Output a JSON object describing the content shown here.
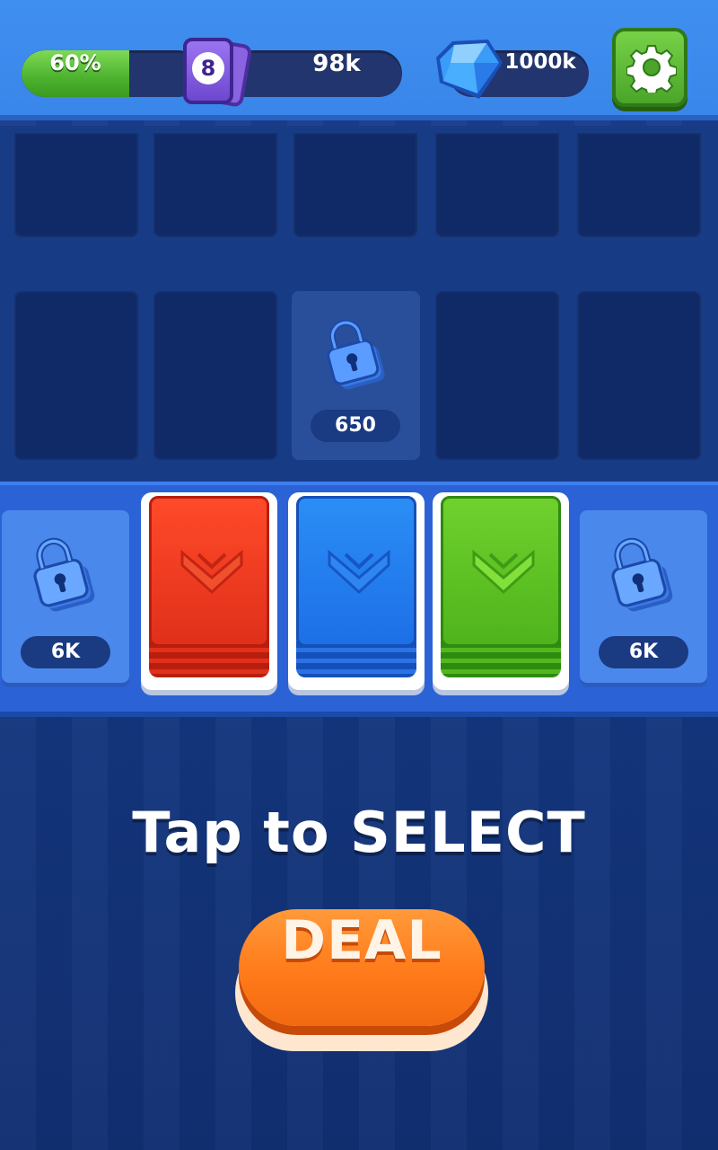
{
  "hud": {
    "progress": {
      "label": "60%",
      "fraction": 0.6
    },
    "cards": {
      "count": "8",
      "value": "98k"
    },
    "gems": {
      "value": "1000k"
    }
  },
  "board": {
    "locked_slot_price": "650"
  },
  "decks": {
    "left_locked_price": "6K",
    "right_locked_price": "6K",
    "stacks": [
      {
        "color": "red"
      },
      {
        "color": "blue"
      },
      {
        "color": "green"
      }
    ]
  },
  "prompt": {
    "text": "Tap to SELECT"
  },
  "deal_button": {
    "label": "DEAL"
  },
  "colors": {
    "background": "#12347a",
    "topbar": "#3a86ea",
    "progress_green": "#4cb22e",
    "card_purple": "#7a55dc",
    "gem_blue": "#2a82f0",
    "settings_green": "#4aa52a",
    "deck_red": "#e0301a",
    "deck_blue": "#1d6fe6",
    "deck_green": "#4fb41c",
    "deal_orange": "#ff7a1a"
  },
  "icons": [
    "gear-icon",
    "card-icon",
    "gem-icon",
    "lock-icon",
    "chevron-down-icon"
  ]
}
